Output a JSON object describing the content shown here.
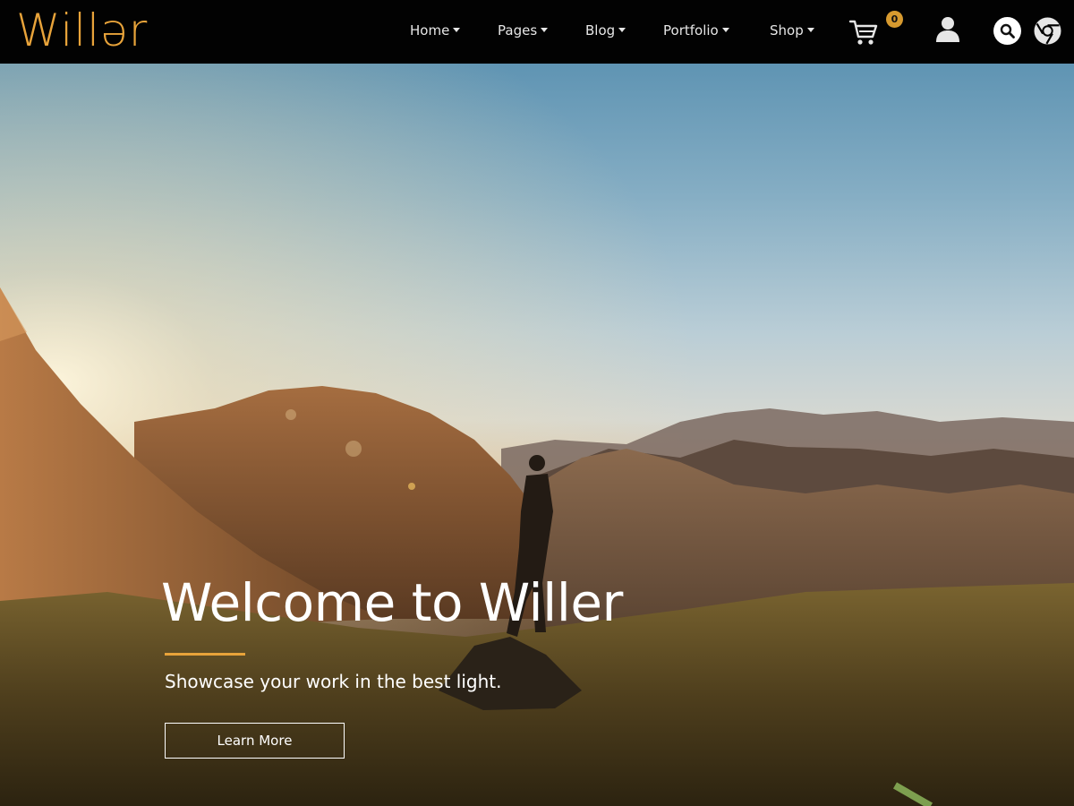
{
  "brand": {
    "logo_text": "Willər",
    "accent_color": "#e8a33a"
  },
  "nav": {
    "items": [
      {
        "label": "Home"
      },
      {
        "label": "Pages"
      },
      {
        "label": "Blog"
      },
      {
        "label": "Portfolio"
      },
      {
        "label": "Shop"
      }
    ],
    "cart_count": "0",
    "icons": [
      "cart-icon",
      "user-icon",
      "search-icon",
      "chrome-icon"
    ]
  },
  "hero": {
    "title": "Welcome to Willer",
    "subtitle": "Showcase your work in the best light.",
    "button_label": "Learn More"
  }
}
